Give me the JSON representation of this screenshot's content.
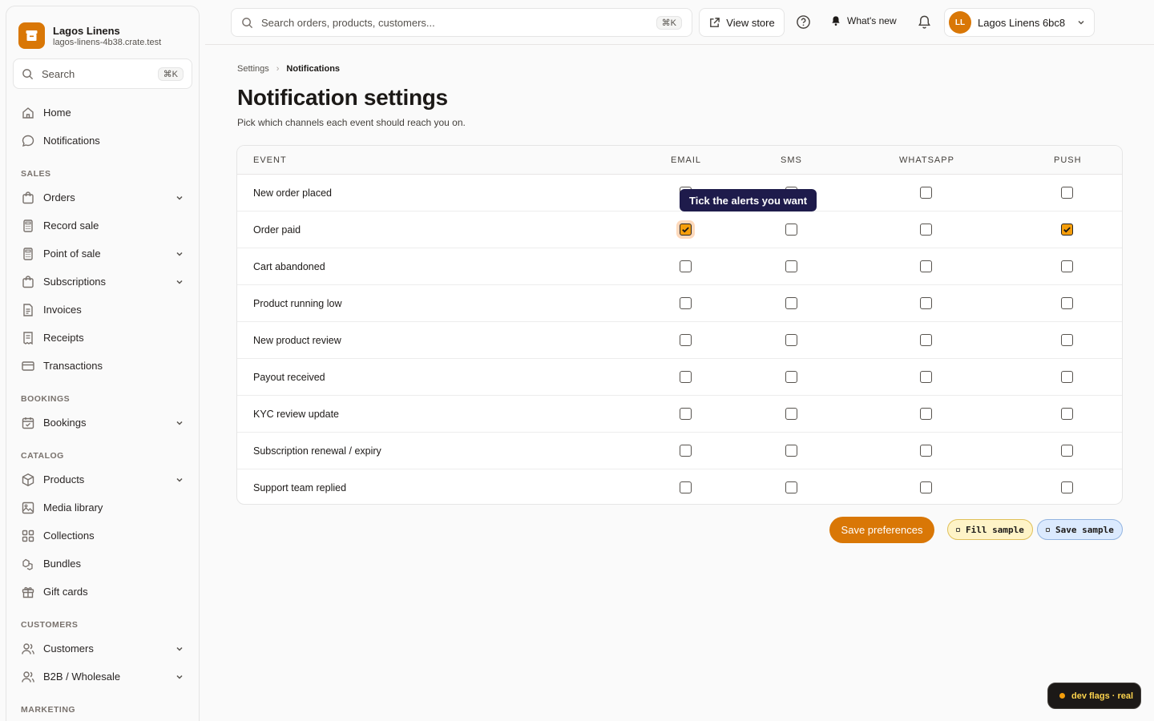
{
  "brand": {
    "name": "Lagos Linens",
    "domain": "lagos-linens-4b38.crate.test"
  },
  "sidebar": {
    "search_placeholder": "Search",
    "search_kbd": "⌘K",
    "top_items": [
      {
        "label": "Home",
        "icon": "home-icon"
      },
      {
        "label": "Notifications",
        "icon": "chat-icon"
      }
    ],
    "sections": [
      {
        "title": "SALES",
        "items": [
          {
            "label": "Orders",
            "icon": "bag-icon",
            "expandable": true
          },
          {
            "label": "Record sale",
            "icon": "calculator-icon",
            "expandable": false
          },
          {
            "label": "Point of sale",
            "icon": "calculator-icon",
            "expandable": true
          },
          {
            "label": "Subscriptions",
            "icon": "bag-icon",
            "expandable": true
          },
          {
            "label": "Invoices",
            "icon": "document-icon",
            "expandable": false
          },
          {
            "label": "Receipts",
            "icon": "receipt-icon",
            "expandable": false
          },
          {
            "label": "Transactions",
            "icon": "card-icon",
            "expandable": false
          }
        ]
      },
      {
        "title": "BOOKINGS",
        "items": [
          {
            "label": "Bookings",
            "icon": "calendar-icon",
            "expandable": true
          }
        ]
      },
      {
        "title": "CATALOG",
        "items": [
          {
            "label": "Products",
            "icon": "box-icon",
            "expandable": true
          },
          {
            "label": "Media library",
            "icon": "image-icon",
            "expandable": false
          },
          {
            "label": "Collections",
            "icon": "grid-icon",
            "expandable": false
          },
          {
            "label": "Bundles",
            "icon": "bundle-icon",
            "expandable": false
          },
          {
            "label": "Gift cards",
            "icon": "gift-icon",
            "expandable": false
          }
        ]
      },
      {
        "title": "CUSTOMERS",
        "items": [
          {
            "label": "Customers",
            "icon": "users-icon",
            "expandable": true
          },
          {
            "label": "B2B / Wholesale",
            "icon": "users-icon",
            "expandable": true
          }
        ]
      },
      {
        "title": "MARKETING",
        "items": []
      }
    ]
  },
  "topbar": {
    "search_placeholder": "Search orders, products, customers...",
    "search_kbd": "⌘K",
    "view_store": "View store",
    "whats_new": "What's new",
    "account_initials": "LL",
    "account_name": "Lagos Linens 6bc8"
  },
  "breadcrumb": {
    "parent": "Settings",
    "current": "Notifications"
  },
  "page": {
    "title": "Notification settings",
    "subtitle": "Pick which channels each event should reach you on."
  },
  "table": {
    "columns": [
      "EVENT",
      "EMAIL",
      "SMS",
      "WHATSAPP",
      "PUSH"
    ],
    "rows": [
      {
        "event": "New order placed",
        "email": false,
        "sms": false,
        "whatsapp": false,
        "push": false
      },
      {
        "event": "Order paid",
        "email": true,
        "sms": false,
        "whatsapp": false,
        "push": true
      },
      {
        "event": "Cart abandoned",
        "email": false,
        "sms": false,
        "whatsapp": false,
        "push": false
      },
      {
        "event": "Product running low",
        "email": false,
        "sms": false,
        "whatsapp": false,
        "push": false
      },
      {
        "event": "New product review",
        "email": false,
        "sms": false,
        "whatsapp": false,
        "push": false
      },
      {
        "event": "Payout received",
        "email": false,
        "sms": false,
        "whatsapp": false,
        "push": false
      },
      {
        "event": "KYC review update",
        "email": false,
        "sms": false,
        "whatsapp": false,
        "push": false
      },
      {
        "event": "Subscription renewal / expiry",
        "email": false,
        "sms": false,
        "whatsapp": false,
        "push": false
      },
      {
        "event": "Support team replied",
        "email": false,
        "sms": false,
        "whatsapp": false,
        "push": false
      }
    ]
  },
  "tooltip": "Tick the alerts you want",
  "actions": {
    "save": "Save preferences",
    "fill_sample": "Fill sample",
    "save_sample": "Save sample"
  },
  "dev_flags": "dev flags · real",
  "colors": {
    "accent": "#d97706",
    "tooltip_bg": "#1e1b4b",
    "checkbox_checked": "#f59e0b"
  }
}
